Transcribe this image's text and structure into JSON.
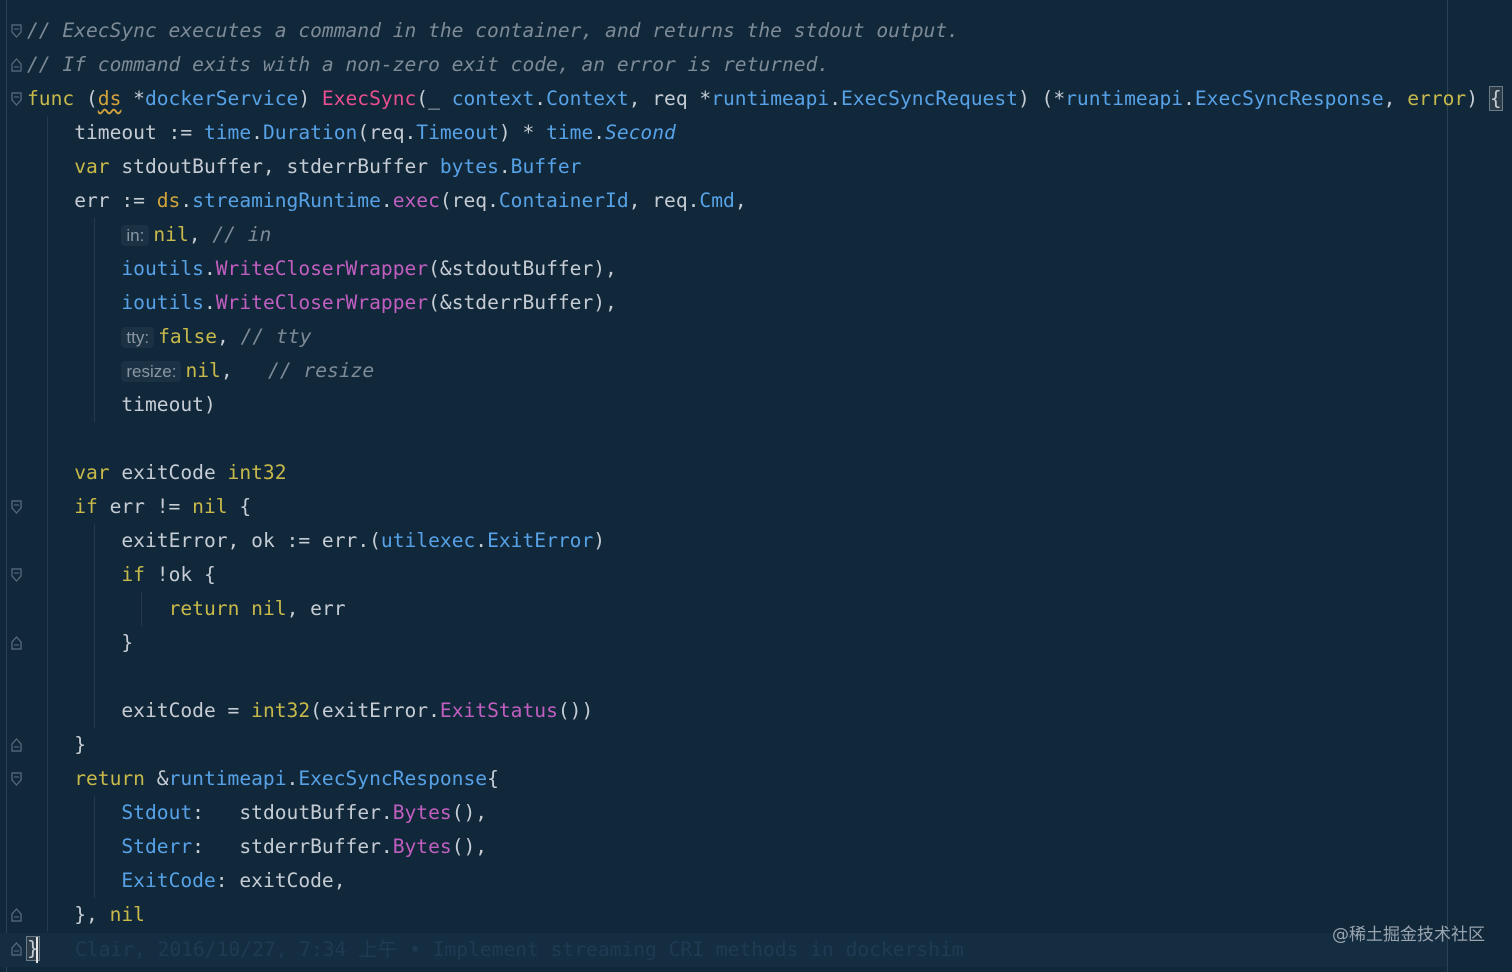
{
  "editor": {
    "language": "go",
    "lines": [
      {
        "indent": 0,
        "tokens": [
          [
            "cm",
            "// ExecSync executes a command in the container, and returns the stdout output."
          ]
        ]
      },
      {
        "indent": 0,
        "tokens": [
          [
            "cm",
            "// If command exits with a non-zero exit code, an error is returned."
          ]
        ]
      },
      {
        "indent": 0,
        "tokens": [
          [
            "kw",
            "func"
          ],
          [
            "tx",
            " ("
          ],
          [
            "rec",
            "ds"
          ],
          [
            "tx",
            " *"
          ],
          [
            "ty",
            "dockerService"
          ],
          [
            "tx",
            ") "
          ],
          [
            "fnd",
            "ExecSync"
          ],
          [
            "tx",
            "(_ "
          ],
          [
            "ty",
            "context"
          ],
          [
            "tx",
            "."
          ],
          [
            "ty",
            "Context"
          ],
          [
            "tx",
            ", req *"
          ],
          [
            "ty",
            "runtimeapi"
          ],
          [
            "tx",
            "."
          ],
          [
            "ty",
            "ExecSyncRequest"
          ],
          [
            "tx",
            ") (*"
          ],
          [
            "ty",
            "runtimeapi"
          ],
          [
            "tx",
            "."
          ],
          [
            "ty",
            "ExecSyncResponse"
          ],
          [
            "tx",
            ", "
          ],
          [
            "kw",
            "error"
          ],
          [
            "tx",
            ") "
          ],
          [
            "brace",
            "{"
          ]
        ]
      },
      {
        "indent": 1,
        "tokens": [
          [
            "tx",
            "timeout := "
          ],
          [
            "ty",
            "time"
          ],
          [
            "tx",
            "."
          ],
          [
            "ty",
            "Duration"
          ],
          [
            "tx",
            "(req."
          ],
          [
            "ty",
            "Timeout"
          ],
          [
            "tx",
            ") * "
          ],
          [
            "ty",
            "time"
          ],
          [
            "tx",
            "."
          ],
          [
            "tyi",
            "Second"
          ]
        ]
      },
      {
        "indent": 1,
        "tokens": [
          [
            "kw",
            "var"
          ],
          [
            "tx",
            " stdoutBuffer, stderrBuffer "
          ],
          [
            "ty",
            "bytes"
          ],
          [
            "tx",
            "."
          ],
          [
            "ty",
            "Buffer"
          ]
        ]
      },
      {
        "indent": 1,
        "tokens": [
          [
            "tx",
            "err := "
          ],
          [
            "kw2",
            "ds"
          ],
          [
            "tx",
            "."
          ],
          [
            "ty",
            "streamingRuntime"
          ],
          [
            "tx",
            "."
          ],
          [
            "fn",
            "exec"
          ],
          [
            "tx",
            "(req."
          ],
          [
            "ty",
            "ContainerId"
          ],
          [
            "tx",
            ", req."
          ],
          [
            "ty",
            "Cmd"
          ],
          [
            "tx",
            ","
          ]
        ]
      },
      {
        "indent": 2,
        "tokens": [
          [
            "hint",
            "in:"
          ],
          [
            "kw",
            "nil"
          ],
          [
            "tx",
            ", "
          ],
          [
            "cm",
            "// in"
          ]
        ]
      },
      {
        "indent": 2,
        "tokens": [
          [
            "ty",
            "ioutils"
          ],
          [
            "tx",
            "."
          ],
          [
            "fn",
            "WriteCloserWrapper"
          ],
          [
            "tx",
            "(&stdoutBuffer),"
          ]
        ]
      },
      {
        "indent": 2,
        "tokens": [
          [
            "ty",
            "ioutils"
          ],
          [
            "tx",
            "."
          ],
          [
            "fn",
            "WriteCloserWrapper"
          ],
          [
            "tx",
            "(&stderrBuffer),"
          ]
        ]
      },
      {
        "indent": 2,
        "tokens": [
          [
            "hint",
            "tty:"
          ],
          [
            "kw",
            "false"
          ],
          [
            "tx",
            ", "
          ],
          [
            "cm",
            "// tty"
          ]
        ]
      },
      {
        "indent": 2,
        "tokens": [
          [
            "hint",
            "resize:"
          ],
          [
            "kw",
            "nil"
          ],
          [
            "tx",
            ",   "
          ],
          [
            "cm",
            "// resize"
          ]
        ]
      },
      {
        "indent": 2,
        "tokens": [
          [
            "tx",
            "timeout)"
          ]
        ]
      },
      {
        "indent": 0,
        "tokens": []
      },
      {
        "indent": 1,
        "tokens": [
          [
            "kw",
            "var"
          ],
          [
            "tx",
            " exitCode "
          ],
          [
            "kw",
            "int32"
          ]
        ]
      },
      {
        "indent": 1,
        "tokens": [
          [
            "kw",
            "if"
          ],
          [
            "tx",
            " err != "
          ],
          [
            "kw",
            "nil"
          ],
          [
            "tx",
            " {"
          ]
        ]
      },
      {
        "indent": 2,
        "tokens": [
          [
            "tx",
            "exitError, ok := err.("
          ],
          [
            "ty",
            "utilexec"
          ],
          [
            "tx",
            "."
          ],
          [
            "ty",
            "ExitError"
          ],
          [
            "tx",
            ")"
          ]
        ]
      },
      {
        "indent": 2,
        "tokens": [
          [
            "kw",
            "if"
          ],
          [
            "tx",
            " !ok {"
          ]
        ]
      },
      {
        "indent": 3,
        "tokens": [
          [
            "kw",
            "return"
          ],
          [
            "tx",
            " "
          ],
          [
            "kw",
            "nil"
          ],
          [
            "tx",
            ", err"
          ]
        ]
      },
      {
        "indent": 2,
        "tokens": [
          [
            "tx",
            "}"
          ]
        ]
      },
      {
        "indent": 0,
        "tokens": []
      },
      {
        "indent": 2,
        "tokens": [
          [
            "tx",
            "exitCode = "
          ],
          [
            "kw",
            "int32"
          ],
          [
            "tx",
            "(exitError."
          ],
          [
            "fn",
            "ExitStatus"
          ],
          [
            "tx",
            "())"
          ]
        ]
      },
      {
        "indent": 1,
        "tokens": [
          [
            "tx",
            "}"
          ]
        ]
      },
      {
        "indent": 1,
        "tokens": [
          [
            "kw",
            "return"
          ],
          [
            "tx",
            " &"
          ],
          [
            "ty",
            "runtimeapi"
          ],
          [
            "tx",
            "."
          ],
          [
            "ty",
            "ExecSyncResponse"
          ],
          [
            "tx",
            "{"
          ]
        ]
      },
      {
        "indent": 2,
        "tokens": [
          [
            "ty",
            "Stdout"
          ],
          [
            "tx",
            ":   stdoutBuffer."
          ],
          [
            "fn",
            "Bytes"
          ],
          [
            "tx",
            "(),"
          ]
        ]
      },
      {
        "indent": 2,
        "tokens": [
          [
            "ty",
            "Stderr"
          ],
          [
            "tx",
            ":   stderrBuffer."
          ],
          [
            "fn",
            "Bytes"
          ],
          [
            "tx",
            "(),"
          ]
        ]
      },
      {
        "indent": 2,
        "tokens": [
          [
            "ty",
            "ExitCode"
          ],
          [
            "tx",
            ": exitCode,"
          ]
        ]
      },
      {
        "indent": 1,
        "tokens": [
          [
            "tx",
            "}, "
          ],
          [
            "kw",
            "nil"
          ]
        ]
      },
      {
        "indent": 0,
        "tokens": [
          [
            "brace",
            "}"
          ]
        ]
      }
    ],
    "fold_markers": [
      {
        "line": 0,
        "kind": "open"
      },
      {
        "line": 1,
        "kind": "close"
      },
      {
        "line": 2,
        "kind": "open"
      },
      {
        "line": 14,
        "kind": "open"
      },
      {
        "line": 16,
        "kind": "open"
      },
      {
        "line": 18,
        "kind": "close"
      },
      {
        "line": 21,
        "kind": "close"
      },
      {
        "line": 22,
        "kind": "open"
      },
      {
        "line": 26,
        "kind": "close"
      },
      {
        "line": 27,
        "kind": "close"
      }
    ],
    "blame_annotation": "Clair, 2016/10/27, 7:34 上午 • Implement streaming CRI methods in dockershim"
  },
  "watermark": "@稀土掘金技术社区",
  "colors": {
    "background": "#11273a",
    "keyword": "#c7b94a",
    "type": "#57a2e6",
    "function": "#c15fc0",
    "function_decl": "#e84f8e",
    "comment": "#7d8b97",
    "text": "#c5ccd4"
  }
}
